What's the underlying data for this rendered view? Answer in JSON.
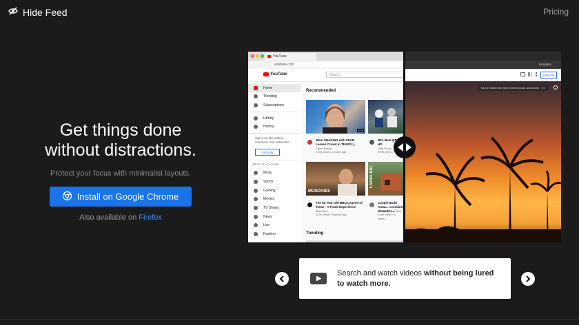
{
  "brand": {
    "name": "Hide Feed",
    "icon": "eye-slash-icon"
  },
  "nav": {
    "pricing": "Pricing"
  },
  "hero": {
    "title_line1": "Get things done",
    "title_line2": "without distractions.",
    "subtitle": "Protect your focus with minimalist layouts.",
    "cta_label": "Install on Google Chrome",
    "also_prefix": "Also available on",
    "also_link": "Firefox"
  },
  "preview": {
    "tab_title": "YouTube",
    "url": "youtube.com",
    "incognito": "Incognito",
    "yt_logo": "YouTube",
    "search_placeholder": "Search",
    "sidebar": [
      "Home",
      "Trending",
      "Subscriptions",
      "Library",
      "History"
    ],
    "signin_prompt": "Sign in to like videos, comment, and subscribe.",
    "signin": "SIGN IN",
    "best_of": "BEST OF YOUTUBE",
    "best_items": [
      "Music",
      "Sports",
      "Gaming",
      "Movies",
      "TV Shows",
      "News",
      "Live",
      "Fashion"
    ],
    "recommended": "Recommended",
    "trending": "Trending",
    "videos": [
      {
        "title": "Mom SHAKING with FEAR Leaves Crowd in TEARS |...",
        "channel": "Talent Recap",
        "meta": "2.2M views • 2 years ago",
        "duration": "6:45"
      },
      {
        "title": "NFL Best QB R... HD",
        "channel": "Ding Produ...",
        "meta": "999K views •"
      },
      {
        "title": "The 84 Year Old BBQ Legend of Texas - A Frank Experience",
        "channel": "Munchies",
        "meta": "927K views • 5 years ago"
      },
      {
        "title": "Couple Build Amaz... Container Home Fre...",
        "channel": "Living Big in A Tiny...",
        "meta": "5.6M views • 3 years..."
      }
    ],
    "thumb_text_munchies": "MUNCHIES",
    "thumb_text_living": "LIVING BIG",
    "notice_text": "You've hidden the feed 4 times today and saved",
    "notice_link": "· Go"
  },
  "feature": {
    "text_plain": "Search and watch videos ",
    "text_bold": "without being lured to watch more.",
    "icon": "video-play-icon"
  },
  "colors": {
    "background": "#1b1b1b",
    "accent": "#1a73e8",
    "link": "#3b8ef0"
  }
}
